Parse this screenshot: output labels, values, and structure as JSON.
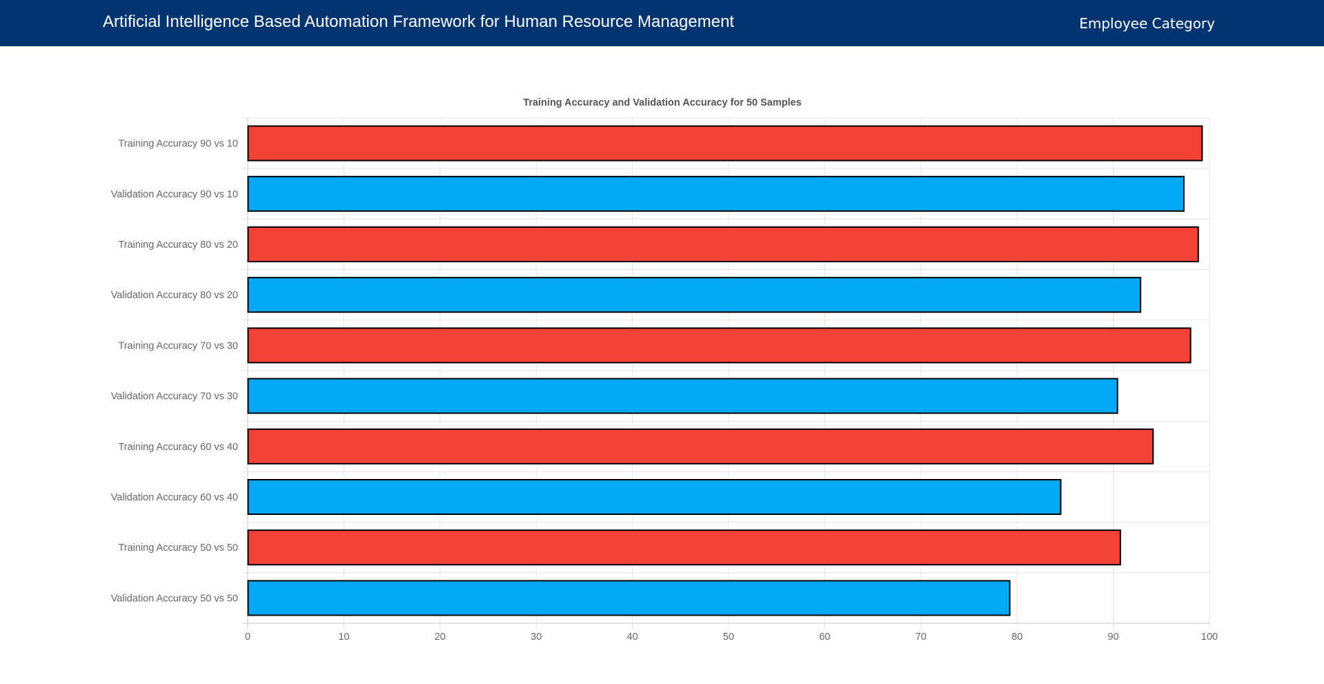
{
  "header": {
    "title": "Artificial Intelligence Based Automation Framework for Human Resource Management",
    "nav_link": "Employee Category",
    "background_color": "#023570"
  },
  "chart_data": {
    "type": "bar",
    "orientation": "horizontal",
    "title": "Training Accuracy and Validation Accuracy for 50 Samples",
    "categories": [
      "Training Accuracy 90 vs 10",
      "Validation Accuracy 90 vs 10",
      "Training Accuracy 80 vs 20",
      "Validation Accuracy 80 vs 20",
      "Training Accuracy 70 vs 30",
      "Validation Accuracy 70 vs 30",
      "Training Accuracy 60 vs 40",
      "Validation Accuracy 60 vs 40",
      "Training Accuracy 50 vs 50",
      "Validation Accuracy 50 vs 50"
    ],
    "values": [
      99.2,
      97.3,
      98.8,
      92.8,
      98.0,
      90.4,
      94.1,
      84.5,
      90.7,
      79.2
    ],
    "bar_colors": [
      "#f44336",
      "#03a9f4",
      "#f44336",
      "#03a9f4",
      "#f44336",
      "#03a9f4",
      "#f44336",
      "#03a9f4",
      "#f44336",
      "#03a9f4"
    ],
    "bar_border_color": "#000000",
    "xlim": [
      0,
      100
    ],
    "xticks": [
      0,
      10,
      20,
      30,
      40,
      50,
      60,
      70,
      80,
      90,
      100
    ],
    "xlabel": "",
    "ylabel": "",
    "grid": true,
    "legend": "none"
  }
}
